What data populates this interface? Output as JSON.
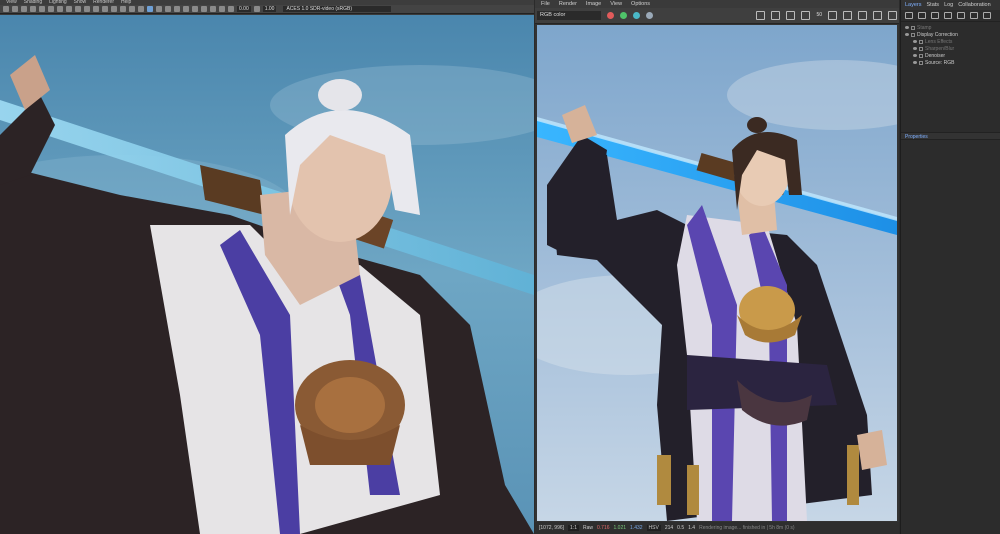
{
  "left_viewport": {
    "menu": [
      "View",
      "Shading",
      "Lighting",
      "Show",
      "Renderer",
      "Help"
    ],
    "toolbar": {
      "field_a": "0.00",
      "field_b": "1.00",
      "color_transform": "ACES 1.0 SDR-video (sRGB)"
    }
  },
  "render_view": {
    "menu": [
      "File",
      "Render",
      "Image",
      "View",
      "Options"
    ],
    "channel_select": "RGB color",
    "zoom_value": "50",
    "status": {
      "coords": "[1072, 996]",
      "ratio": "1:1",
      "mode": "Raw",
      "r": "0.716",
      "g": "1.021",
      "b": "1.432",
      "space": "HSV",
      "h": "214",
      "s": "0.5",
      "v": "1.4",
      "progress_text": "Rendering image... finished in | 5h 8m (0 s)"
    }
  },
  "panel": {
    "tabs": [
      "Layers",
      "Stats",
      "Log",
      "Collaboration"
    ],
    "active_tab": "Layers",
    "layers": [
      {
        "label": "Stamp",
        "dim": true
      },
      {
        "label": "Display Correction",
        "dim": false
      },
      {
        "label": "Lens Effects",
        "dim": true
      },
      {
        "label": "Sharpen/Blur",
        "dim": true
      },
      {
        "label": "Denoiser",
        "dim": false
      },
      {
        "label": "Source: RGB",
        "dim": false
      }
    ],
    "properties_label": "Properties"
  },
  "colors": {
    "accent_blue": "#7fb0ff",
    "sky_left": "#5f98b8",
    "sky_right": "#9ab7d6",
    "dot_red": "#e25b5b",
    "dot_green": "#4fc46a",
    "dot_teal": "#4ab8c8"
  }
}
